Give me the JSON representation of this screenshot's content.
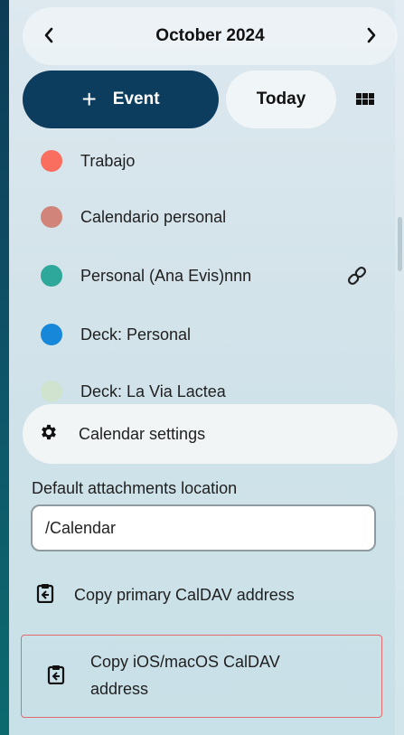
{
  "header": {
    "month_label": "October 2024",
    "prev_icon": "chevron-left-icon",
    "next_icon": "chevron-right-icon"
  },
  "actions": {
    "new_event_plus": "+",
    "new_event_label": "Event",
    "today_label": "Today",
    "view_icon": "grid-icon"
  },
  "calendars": [
    {
      "name": "Trabajo",
      "color": "#f96e5f"
    },
    {
      "name": "Calendario personal",
      "color": "#d1857a"
    },
    {
      "name": "Personal (Ana Evis)nnn",
      "color": "#2ea89a",
      "shared": true,
      "shared_icon": "link-icon"
    },
    {
      "name": "Deck: Personal",
      "color": "#1687d9"
    },
    {
      "name": "Deck: La Via Lactea",
      "color": "#d0e3cf"
    }
  ],
  "settings": {
    "label": "Calendar settings",
    "icon": "gear-icon",
    "attachments_label": "Default attachments location",
    "attachments_value": "/Calendar",
    "copy_primary_label": "Copy primary CalDAV address",
    "copy_ios_label": "Copy iOS/macOS CalDAV address",
    "copy_icon": "clipboard-icon"
  },
  "colors": {
    "primary": "#0c3d5f",
    "highlight_border": "#e26b6b"
  }
}
